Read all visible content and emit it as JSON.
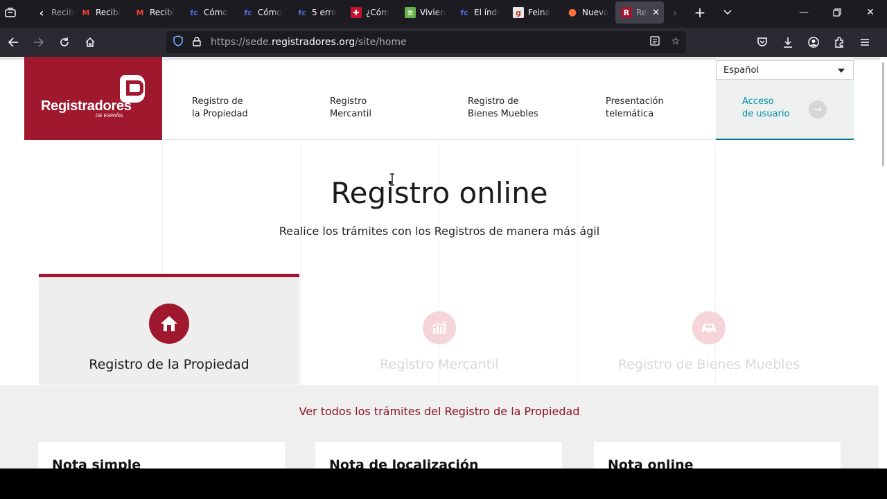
{
  "browser": {
    "tabs": [
      {
        "label": "Recibi",
        "fav": "‹",
        "favbg": "transparent",
        "favcolor": "#fbfbfe"
      },
      {
        "label": "Recibi",
        "fav": "M",
        "favbg": "transparent",
        "favcolor": "#ea4335"
      },
      {
        "label": "Recibi",
        "fav": "M",
        "favbg": "transparent",
        "favcolor": "#ea4335"
      },
      {
        "label": "Cómo",
        "fav": "fc",
        "favbg": "transparent",
        "favcolor": "#4a6ee0"
      },
      {
        "label": "Cómo",
        "fav": "fc",
        "favbg": "transparent",
        "favcolor": "#4a6ee0"
      },
      {
        "label": "5 erro",
        "fav": "fc",
        "favbg": "transparent",
        "favcolor": "#4a6ee0"
      },
      {
        "label": "¿Cóm",
        "fav": "✚",
        "favbg": "#c8102e",
        "favcolor": "#ffffff"
      },
      {
        "label": "Vivien",
        "fav": "≡",
        "favbg": "#6ab04c",
        "favcolor": "#ffffff"
      },
      {
        "label": "El índi",
        "fav": "fc",
        "favbg": "transparent",
        "favcolor": "#4a6ee0"
      },
      {
        "label": "Feina",
        "fav": "g",
        "favbg": "#e8e8e8",
        "favcolor": "#c0392b"
      },
      {
        "label": "Nueva",
        "fav": "●",
        "favbg": "transparent",
        "favcolor": "#ff7139"
      },
      {
        "label": "Reg",
        "fav": "R",
        "favbg": "#a0182e",
        "favcolor": "#ffffff"
      }
    ],
    "url_prefix": "https://sede.",
    "url_domain": "registradores.org",
    "url_path": "/site/home"
  },
  "header": {
    "logo_name": "Registradores",
    "logo_sub": "DE ESPAÑA",
    "menu": [
      {
        "line1": "Registro de",
        "line2": "la Propiedad"
      },
      {
        "line1": "Registro",
        "line2": "Mercantil"
      },
      {
        "line1": "Registro de",
        "line2": "Bienes Muebles"
      },
      {
        "line1": "Presentación",
        "line2": "telemática"
      }
    ],
    "access_line1": "Acceso",
    "access_line2": "de usuario",
    "language": "Español"
  },
  "hero": {
    "title": "Registro online",
    "subtitle": "Realice los trámites con los Registros de manera más ágil"
  },
  "categories": [
    {
      "label": "Registro de la Propiedad",
      "icon": "house-icon"
    },
    {
      "label": "Registro Mercantil",
      "icon": "building-chart-icon"
    },
    {
      "label": "Registro de Bienes Muebles",
      "icon": "car-icon"
    }
  ],
  "lower": {
    "see_all": "Ver todos los trámites del Registro de la Propiedad",
    "cards": [
      "Nota simple",
      "Nota de localización",
      "Nota online"
    ]
  },
  "colors": {
    "brand": "#a0182e",
    "accent": "#0091a5"
  }
}
